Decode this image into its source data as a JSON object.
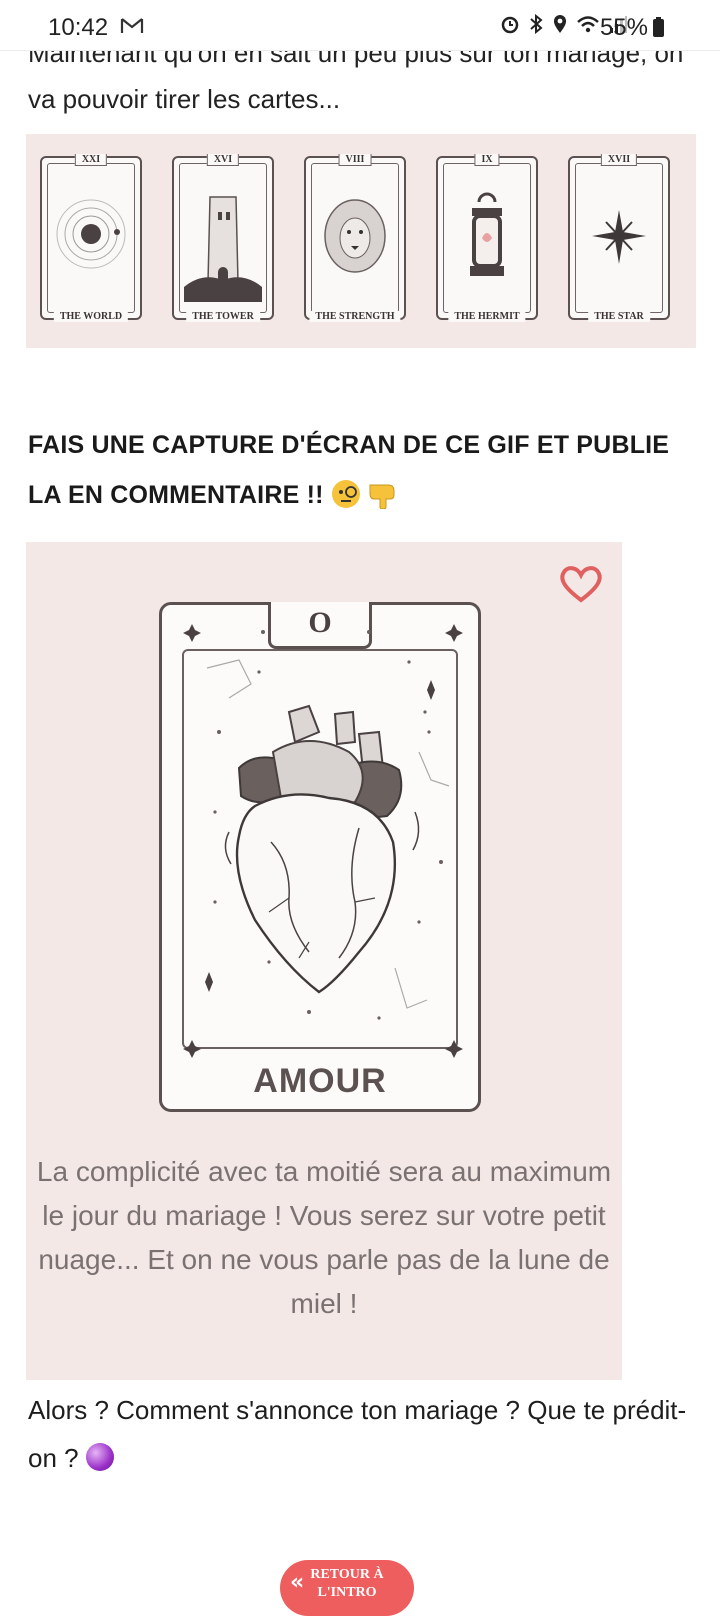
{
  "status_bar": {
    "time": "10:42",
    "battery_pct": "55%"
  },
  "intro_text": "Maintenant qu'on en sait un peu plus sur ton mariage, on va pouvoir tirer les cartes...",
  "tarot_strip": {
    "cards": [
      {
        "number": "XXI",
        "name": "THE WORLD"
      },
      {
        "number": "XVI",
        "name": "THE TOWER"
      },
      {
        "number": "VIII",
        "name": "THE STRENGTH"
      },
      {
        "number": "IX",
        "name": "THE HERMIT"
      },
      {
        "number": "XVII",
        "name": "THE STAR"
      }
    ]
  },
  "heading": "FAIS UNE CAPTURE D'ÉCRAN DE CE GIF ET PUBLIE LA EN COMMENTAIRE !!",
  "big_card": {
    "number": "O",
    "title": "AMOUR",
    "caption": "La complicité avec ta moitié sera au maximum le jour du mariage ! Vous serez sur votre petit nuage... Et on ne vous parle pas de la lune de miel !"
  },
  "question": "Alors ? Comment s'annonce ton mariage ? Que te prédit-on ?",
  "retour_button": {
    "line1": "RETOUR À",
    "line2": "L'INTRO"
  },
  "colors": {
    "card_bg": "#f3e8e6",
    "button_red": "#ef5e5e",
    "heart_red": "#e06060"
  }
}
